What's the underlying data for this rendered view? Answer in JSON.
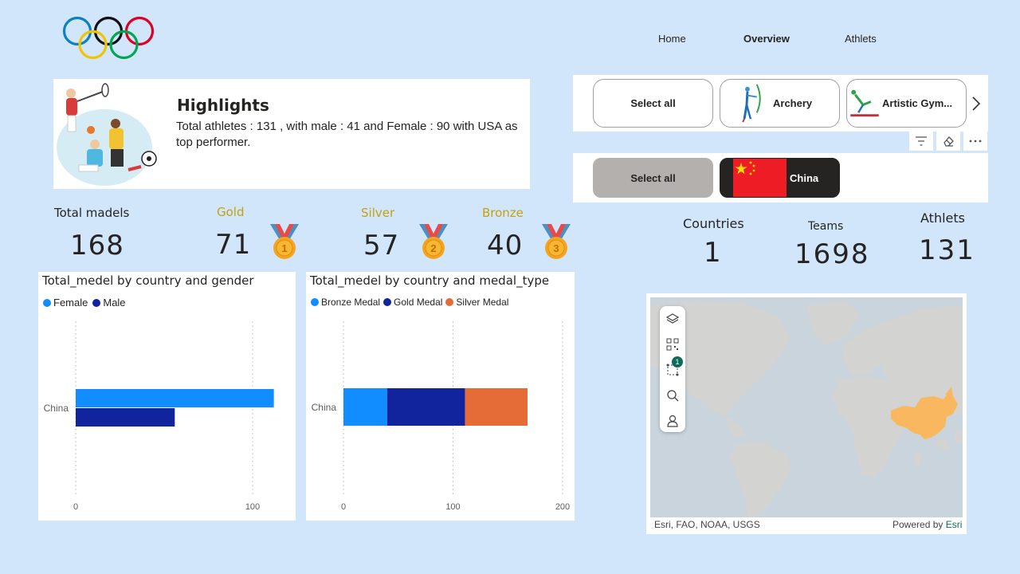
{
  "colors": {
    "female": "#118dff",
    "male": "#12239e",
    "bronze": "#118dff",
    "gold": "#12239e",
    "silver": "#e66c37",
    "china_map": "#f9b860",
    "gold_label": "#c3a20f"
  },
  "nav": {
    "home": "Home",
    "overview": "Overview",
    "athlets": "Athlets"
  },
  "highlights": {
    "title": "Highlights",
    "text": "Total athletes : 131 , with male : 41 and Female : 90 with USA as top performer."
  },
  "kpis": {
    "total_label": "Total madels",
    "total_value": "168",
    "gold_label": "Gold",
    "gold_value": "71",
    "silver_label": "Silver",
    "silver_value": "57",
    "bronze_label": "Bronze",
    "bronze_value": "40"
  },
  "sport_slicer": {
    "items": [
      "Select all",
      "Archery",
      "Artistic Gym..."
    ]
  },
  "slicer_toolbar": {
    "icons": [
      "filter-icon",
      "eraser-icon",
      "more-options-icon"
    ]
  },
  "country_slicer": {
    "items": [
      "Select all",
      "China"
    ]
  },
  "stats": {
    "countries_label": "Countries",
    "countries_value": "1",
    "teams_label": "Teams",
    "teams_value": "1698",
    "athletes_label": "Athlets",
    "athletes_value": "131"
  },
  "chart_data": [
    {
      "type": "bar",
      "title": "Total_medel by country and gender",
      "categories": [
        "China"
      ],
      "series": [
        {
          "name": "Female",
          "values": [
            112
          ]
        },
        {
          "name": "Male",
          "values": [
            56
          ]
        }
      ],
      "xticks": [
        "0",
        "100"
      ],
      "xlim": [
        0,
        158
      ]
    },
    {
      "type": "bar",
      "stacked": true,
      "title": "Total_medel by country and medal_type",
      "categories": [
        "China"
      ],
      "series": [
        {
          "name": "Bronze Medal",
          "values": [
            40
          ]
        },
        {
          "name": "Gold Medal",
          "values": [
            71
          ]
        },
        {
          "name": "Silver Medal",
          "values": [
            57
          ]
        }
      ],
      "xticks": [
        "0",
        "100",
        "200"
      ],
      "xlim": [
        0,
        200
      ]
    }
  ],
  "map": {
    "attribution": "Esri, FAO, NOAA, USGS",
    "powered_by": "Powered by",
    "powered_link": "Esri",
    "selection_badge": "1",
    "tools": [
      "layers-icon",
      "qr-code-icon",
      "selection-icon",
      "search-icon",
      "user-location-icon"
    ]
  }
}
